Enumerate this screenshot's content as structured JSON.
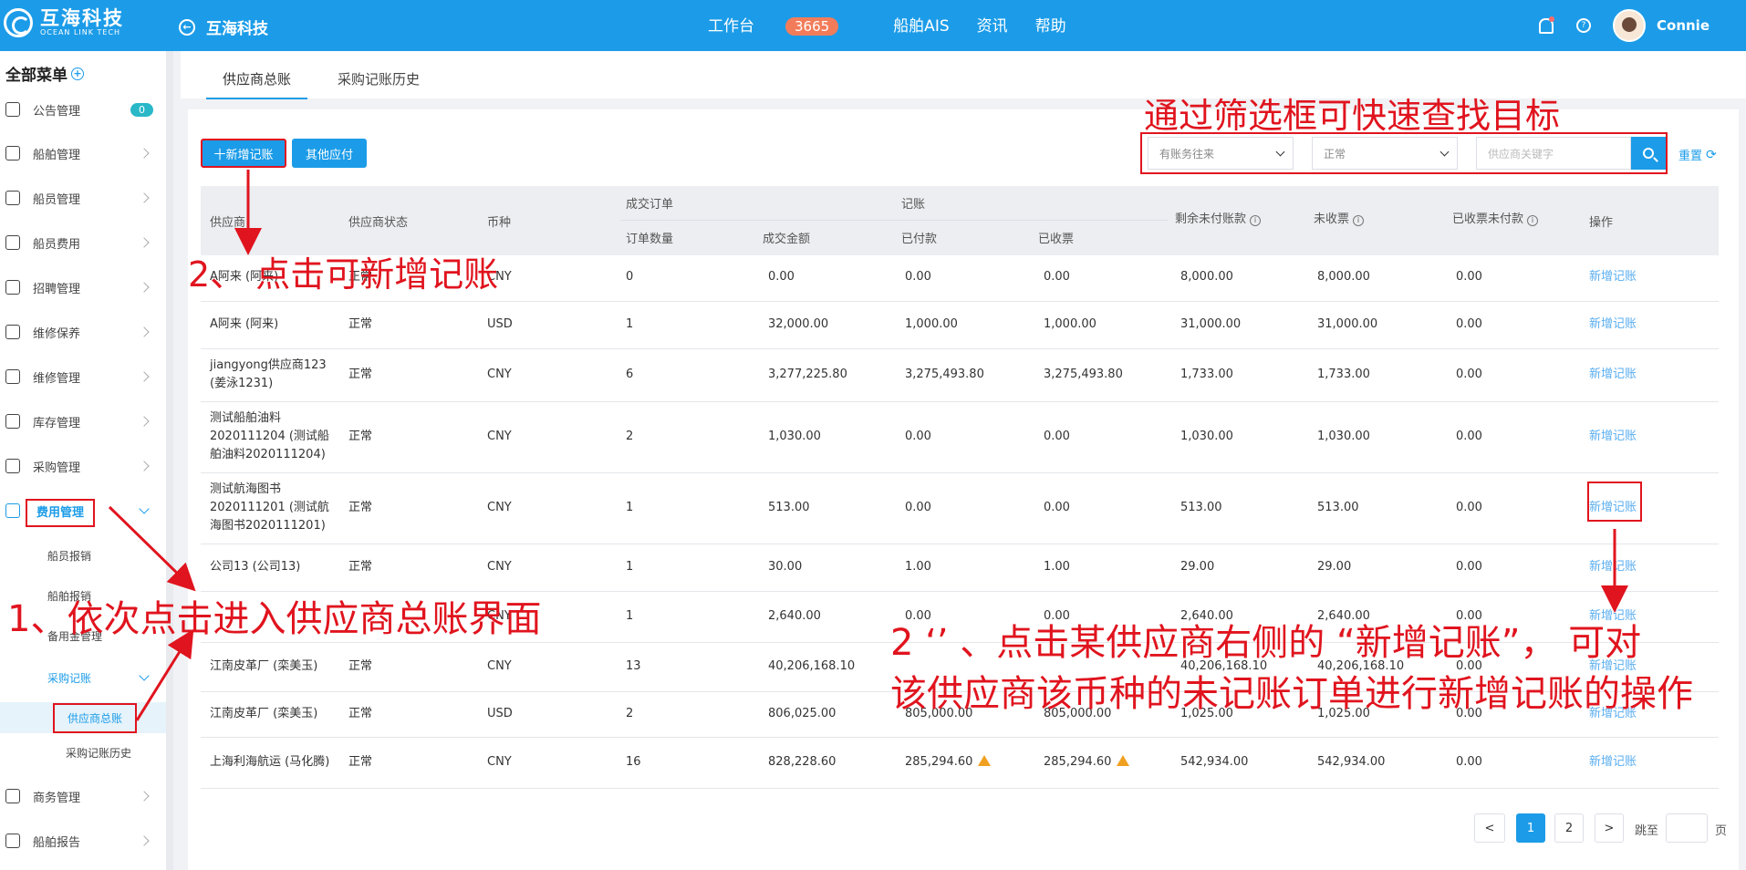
{
  "header": {
    "logo_cn": "互海科技",
    "logo_en": "OCEAN LINK TECH",
    "back_title": "互海科技",
    "nav": {
      "workbench": "工作台",
      "workbench_count": "3665",
      "ais": "船舶AIS",
      "news": "资讯",
      "help": "帮助"
    },
    "username": "Connie"
  },
  "sidebar": {
    "title": "全部菜单",
    "announcement": {
      "label": "公告管理",
      "badge": "0"
    },
    "items": [
      "船舶管理",
      "船员管理",
      "船员费用",
      "招聘管理",
      "维修保养",
      "维修管理",
      "库存管理",
      "采购管理"
    ],
    "expense": {
      "label": "费用管理",
      "subs": [
        "船员报销",
        "船舶报销",
        "备用金管理"
      ],
      "purchase_ledger": "采购记账",
      "supplier_ledger": "供应商总账",
      "purchase_history": "采购记账历史"
    },
    "bottom_items": [
      "商务管理",
      "船舶报告"
    ]
  },
  "tabs": [
    "供应商总账",
    "采购记账历史"
  ],
  "toolbar": {
    "add_ledger": "十新增记账",
    "other_payable": "其他应付",
    "filter1": "有账务往来",
    "filter2": "正常",
    "search_placeholder": "供应商关键字",
    "reset": "重置"
  },
  "table": {
    "headers": {
      "supplier": "供应商",
      "status": "供应商状态",
      "currency": "币种",
      "deal_orders": "成交订单",
      "order_count": "订单数量",
      "deal_amount": "成交金额",
      "bookkeeping": "记账",
      "paid": "已付款",
      "invoiced": "已收票",
      "remaining_unpaid": "剩余未付账款",
      "not_invoiced": "未收票",
      "invoiced_unpaid": "已收票未付款",
      "operation": "操作"
    },
    "rows": [
      {
        "supplier": "A阿来 (阿来)",
        "status": "正常",
        "currency": "CNY",
        "count": "0",
        "amount": "0.00",
        "paid": "0.00",
        "invoiced": "0.00",
        "remaining": "8,000.00",
        "not_invoiced": "8,000.00",
        "inv_unpaid": "0.00",
        "op": "新增记账"
      },
      {
        "supplier": "A阿来 (阿来)",
        "status": "正常",
        "currency": "USD",
        "count": "1",
        "amount": "32,000.00",
        "paid": "1,000.00",
        "invoiced": "1,000.00",
        "remaining": "31,000.00",
        "not_invoiced": "31,000.00",
        "inv_unpaid": "0.00",
        "op": "新增记账"
      },
      {
        "supplier": "jiangyong供应商123 (姜泳1231)",
        "status": "正常",
        "currency": "CNY",
        "count": "6",
        "amount": "3,277,225.80",
        "paid": "3,275,493.80",
        "invoiced": "3,275,493.80",
        "remaining": "1,733.00",
        "not_invoiced": "1,733.00",
        "inv_unpaid": "0.00",
        "op": "新增记账"
      },
      {
        "supplier": "测试船舶油料2020111204 (测试船舶油料2020111204)",
        "status": "正常",
        "currency": "CNY",
        "count": "2",
        "amount": "1,030.00",
        "paid": "0.00",
        "invoiced": "0.00",
        "remaining": "1,030.00",
        "not_invoiced": "1,030.00",
        "inv_unpaid": "0.00",
        "op": "新增记账"
      },
      {
        "supplier": "测试航海图书2020111201 (测试航海图书2020111201)",
        "status": "正常",
        "currency": "CNY",
        "count": "1",
        "amount": "513.00",
        "paid": "0.00",
        "invoiced": "0.00",
        "remaining": "513.00",
        "not_invoiced": "513.00",
        "inv_unpaid": "0.00",
        "op": "新增记账"
      },
      {
        "supplier": "公司13 (公司13)",
        "status": "正常",
        "currency": "CNY",
        "count": "1",
        "amount": "30.00",
        "paid": "1.00",
        "invoiced": "1.00",
        "remaining": "29.00",
        "not_invoiced": "29.00",
        "inv_unpaid": "0.00",
        "op": "新增记账"
      },
      {
        "supplier": "",
        "status": "",
        "currency": "CNY",
        "count": "1",
        "amount": "2,640.00",
        "paid": "0.00",
        "invoiced": "0.00",
        "remaining": "2,640.00",
        "not_invoiced": "2,640.00",
        "inv_unpaid": "0.00",
        "op": "新增记账"
      },
      {
        "supplier": "江南皮革厂 (栾美玉)",
        "status": "正常",
        "currency": "CNY",
        "count": "13",
        "amount": "40,206,168.10",
        "paid": "",
        "invoiced": "",
        "remaining": "40,206,168.10",
        "not_invoiced": "40,206,168.10",
        "inv_unpaid": "0.00",
        "op": "新增记账"
      },
      {
        "supplier": "江南皮革厂 (栾美玉)",
        "status": "正常",
        "currency": "USD",
        "count": "2",
        "amount": "806,025.00",
        "paid": "805,000.00",
        "invoiced": "805,000.00",
        "remaining": "1,025.00",
        "not_invoiced": "1,025.00",
        "inv_unpaid": "0.00",
        "op": "新增记账"
      },
      {
        "supplier": "上海利海航运 (马化腾)",
        "status": "正常",
        "currency": "CNY",
        "count": "16",
        "amount": "828,228.60",
        "paid": "285,294.60",
        "invoiced": "285,294.60",
        "remaining": "542,934.00",
        "not_invoiced": "542,934.00",
        "inv_unpaid": "0.00",
        "op": "新增记账"
      }
    ]
  },
  "pagination": {
    "prev": "<",
    "page1": "1",
    "page2": "2",
    "next": ">",
    "jump": "跳至",
    "page_suffix": "页"
  },
  "annotations": {
    "filter_tip": "通过筛选框可快速查找目标",
    "add_tip": "2、 点击可新增记账",
    "step1": "1、依次点击进入供应商总账界面",
    "step2_line1": "2 ‘’  、点击某供应商右侧的 “新增记账”， 可对",
    "step2_line2": "该供应商该币种的未记账订单进行新增记账的操作"
  },
  "colors": {
    "brand": "#1c9ce8",
    "annotation": "#e0141e",
    "link": "#5aaef0"
  }
}
